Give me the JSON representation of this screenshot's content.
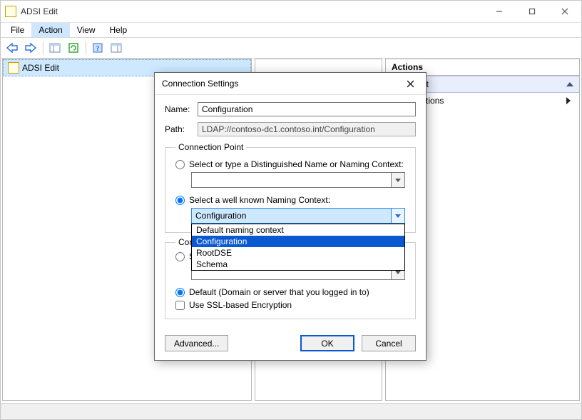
{
  "window": {
    "title": "ADSI Edit"
  },
  "menu": {
    "file": "File",
    "action": "Action",
    "view": "View",
    "help": "Help"
  },
  "tree": {
    "root": "ADSI Edit"
  },
  "actions": {
    "header": "Actions",
    "section": "ADSI Edit",
    "more": "More Actions"
  },
  "dialog": {
    "title": "Connection Settings",
    "name_label": "Name:",
    "name_value": "Configuration",
    "path_label": "Path:",
    "path_value": "LDAP://contoso-dc1.contoso.int/Configuration",
    "cp_legend": "Connection Point",
    "cp_radio_dn": "Select or type a Distinguished Name or Naming Context:",
    "cp_radio_nc": "Select a well known Naming Context:",
    "cp_nc_value": "Configuration",
    "cp_nc_options": {
      "0": "Default naming context",
      "1": "Configuration",
      "2": "RootDSE",
      "3": "Schema"
    },
    "comp_legend": "Computer",
    "comp_radio_select_prefix": "Se",
    "comp_radio_default": "Default (Domain or server that you logged in to)",
    "ssl_label": "Use SSL-based Encryption",
    "advanced": "Advanced...",
    "ok": "OK",
    "cancel": "Cancel"
  }
}
